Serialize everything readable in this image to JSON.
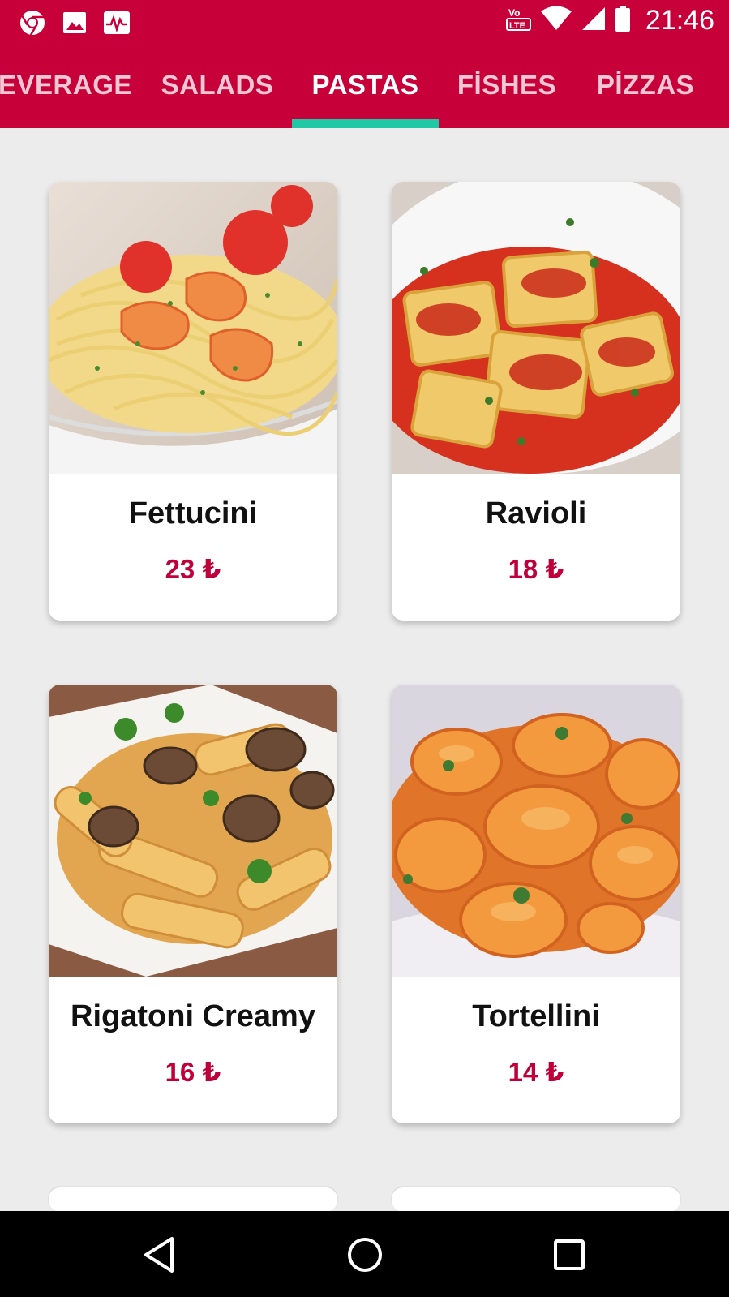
{
  "status_bar": {
    "time": "21:46",
    "left_icons": [
      "chrome-icon",
      "image-icon",
      "activity-icon"
    ],
    "right_icons": [
      "volte-icon",
      "wifi-icon",
      "cell-signal-icon",
      "battery-icon"
    ],
    "volte_text": "LTE"
  },
  "tabs": [
    {
      "label": "EVERAGE",
      "active": false
    },
    {
      "label": "SALADS",
      "active": false
    },
    {
      "label": "PASTAS",
      "active": true
    },
    {
      "label": "FİSHES",
      "active": false
    },
    {
      "label": "PİZZAS",
      "active": false
    }
  ],
  "colors": {
    "primary": "#c8003a",
    "accent": "#1fc9a6",
    "price": "#c0003a",
    "background": "#ececec"
  },
  "products": [
    {
      "name": "Fettucini",
      "price": "23 ₺",
      "image": "fettucini-shrimp-pasta-photo"
    },
    {
      "name": "Ravioli",
      "price": "18 ₺",
      "image": "ravioli-tomato-sauce-photo"
    },
    {
      "name": "Rigatoni Creamy",
      "price": "16 ₺",
      "image": "rigatoni-mushroom-pasta-photo"
    },
    {
      "name": "Tortellini",
      "price": "14 ₺",
      "image": "tortellini-creamy-sauce-photo"
    }
  ],
  "nav": [
    "back-icon",
    "home-icon",
    "recents-icon"
  ]
}
